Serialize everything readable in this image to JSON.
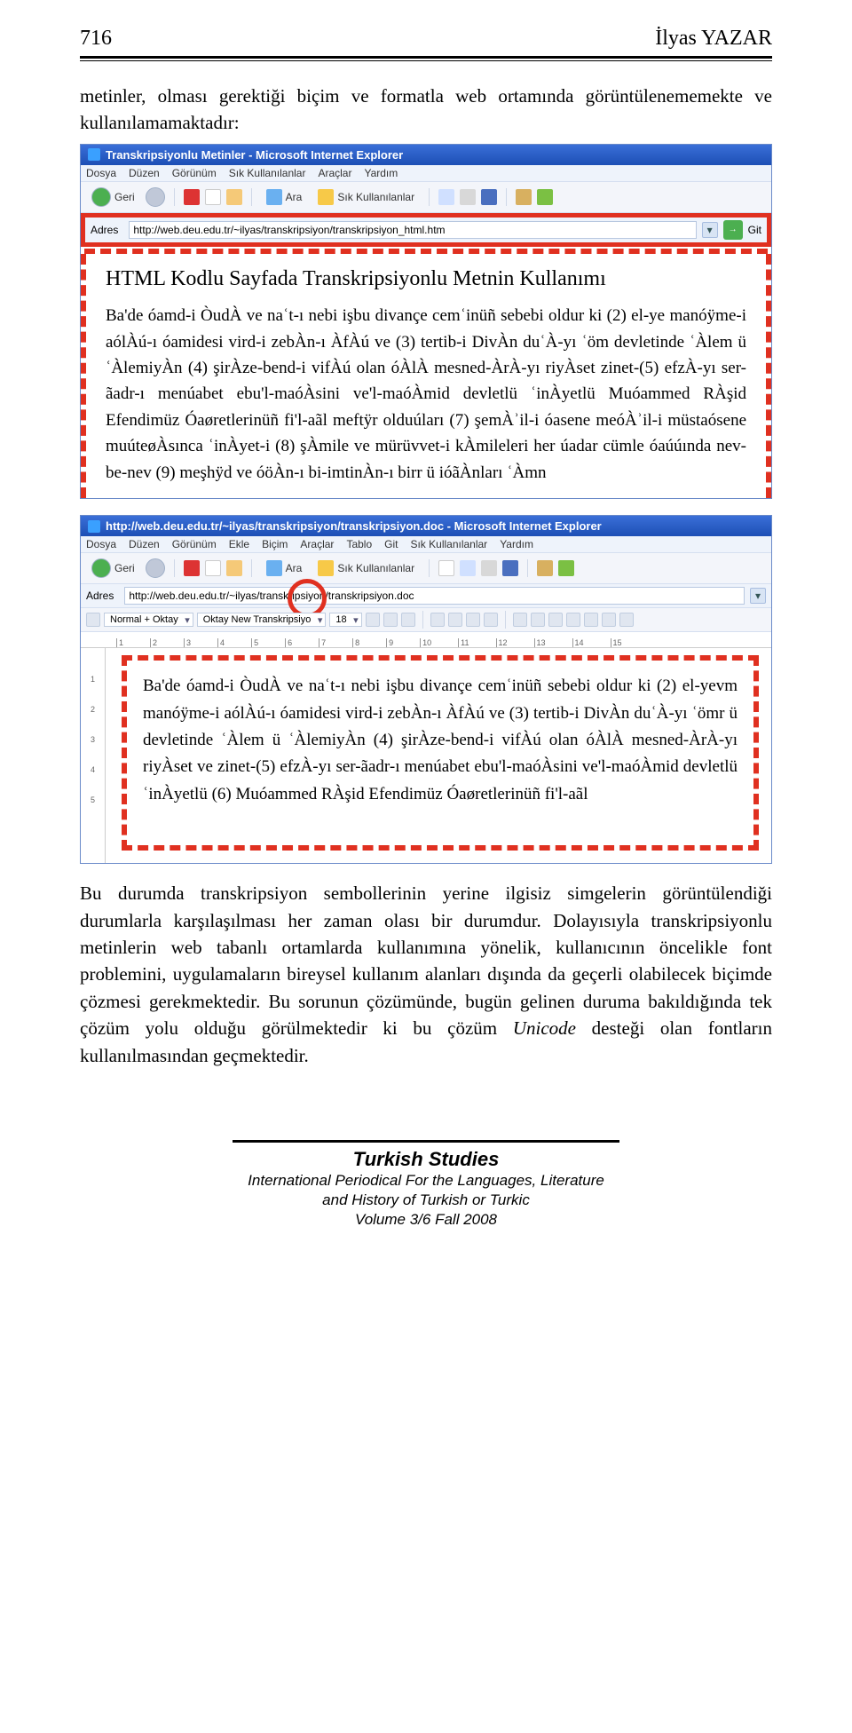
{
  "header": {
    "page_num": "716",
    "author": "İlyas YAZAR"
  },
  "intro": "metinler, olması gerektiği biçim ve formatla web ortamında görüntülenememekte ve kullanılamamaktadır:",
  "ie1": {
    "title": "Transkripsiyonlu Metinler - Microsoft Internet Explorer",
    "menu": [
      "Dosya",
      "Düzen",
      "Görünüm",
      "Sık Kullanılanlar",
      "Araçlar",
      "Yardım"
    ],
    "back": "Geri",
    "search": "Ara",
    "fav": "Sık Kullanılanlar",
    "addr_label": "Adres",
    "url": "http://web.deu.edu.tr/~ilyas/transkripsiyon/transkripsiyon_html.htm",
    "go": "Git",
    "content_title": "HTML Kodlu Sayfada Transkripsiyonlu Metnin Kullanımı",
    "content_body": "Ba'de óamd-i ÒudÀ ve naʿt-ı nebi işbu divançe cemʿinüñ sebebi oldur ki (2) el-ye manóÿme-i aólÀú-ı óamidesi vird-i zebÀn-ı ÀfÀú ve (3) tertib-i DivÀn duʿÀ-yı ʿöm devletinde ʿÀlem ü ʿÀlemiyÀn (4) şirÀze-bend-i vifÀú olan óÀlÀ mesned-ÀrÀ-yı riyÀset zinet-(5) efzÀ-yı ser-ãadr-ı menúabet ebu'l-maóÀsini ve'l-maóÀmid devletlü ʿinÀyetlü Muóammed RÀşid Efendimüz Óaøretlerinüñ fi'l-aãl meftÿr olduúları (7) şemÀʾil-i óasene meóÀʾil-i müstaósene muúteøÀsınca ʿinÀyet-i (8) şÀmile ve mürüvvet-i kÀmileleri her úadar cümle óaúúında nev-be-nev (9) meşhÿd ve óöÀn-ı bi-imtinÀn-ı birr ü ióãÀnları ʿÀmn"
  },
  "ie2": {
    "title": "http://web.deu.edu.tr/~ilyas/transkripsiyon/transkripsiyon.doc - Microsoft Internet Explorer",
    "menu": [
      "Dosya",
      "Düzen",
      "Görünüm",
      "Ekle",
      "Biçim",
      "Araçlar",
      "Tablo",
      "Git",
      "Sık Kullanılanlar",
      "Yardım"
    ],
    "back": "Geri",
    "search": "Ara",
    "fav": "Sık Kullanılanlar",
    "addr_label": "Adres",
    "url": "http://web.deu.edu.tr/~ilyas/transkripsiyon/transkripsiyon.doc",
    "style": "Normal + Oktay",
    "font": "Oktay New Transkripsiyo",
    "size": "18",
    "ruler_top": [
      "1",
      "2",
      "3",
      "4",
      "5",
      "6",
      "7",
      "8",
      "9",
      "10",
      "11",
      "12",
      "13",
      "14",
      "15"
    ],
    "ruler_left": [
      "",
      "1",
      "2",
      "3",
      "4",
      "5"
    ],
    "content_body": "Ba'de óamd-i ÒudÀ ve naʿt-ı nebi işbu divançe cemʿinüñ sebebi oldur ki (2) el-yevm manóÿme-i aólÀú-ı óamidesi vird-i zebÀn-ı ÀfÀú ve (3) tertib-i DivÀn duʿÀ-yı ʿömr ü devletinde ʿÀlem ü ʿÀlemiyÀn (4) şirÀze-bend-i vifÀú olan óÀlÀ mesned-ÀrÀ-yı riyÀset ve zinet-(5) efzÀ-yı ser-ãadr-ı menúabet ebu'l-maóÀsini ve'l-maóÀmid devletlü ʿinÀyetlü (6) Muóammed RÀşid Efendimüz Óaøretlerinüñ fi'l-aãl"
  },
  "para2_pre": "Bu durumda transkripsiyon sembollerinin yerine ilgisiz simgelerin görüntülendiği durumlarla karşılaşılması her zaman olası bir durumdur. Dolayısıyla transkripsiyonlu metinlerin web tabanlı ortamlarda kullanımına yönelik, kullanıcının öncelikle font problemini, uygulamaların bireysel kullanım alanları dışında da geçerli olabilecek biçimde çözmesi gerekmektedir. Bu sorunun çözümünde, bugün gelinen duruma bakıldığında tek çözüm yolu olduğu görülmektedir ki bu çözüm ",
  "para2_em": "Unicode",
  "para2_post": " desteği olan fontların kullanılmasından geçmektedir.",
  "footer": {
    "t1": "Turkish Studies",
    "t2": "International Periodical For the Languages, Literature",
    "t3": "and History of Turkish or Turkic",
    "t4": "Volume 3/6 Fall 2008"
  }
}
